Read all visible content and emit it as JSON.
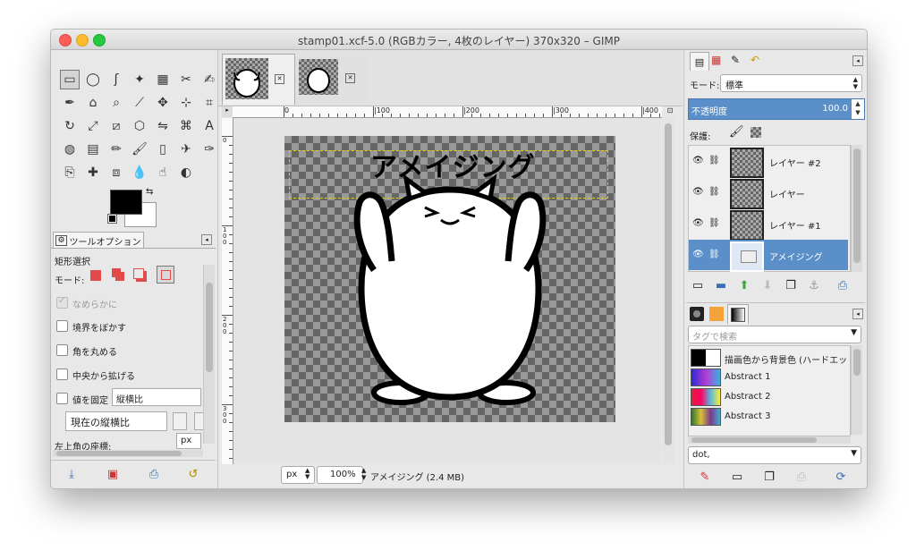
{
  "window": {
    "title": "stamp01.xcf-5.0 (RGBカラー, 4枚のレイヤー) 370x320 – GIMP"
  },
  "toolbox": {
    "tools": [
      "rect-select",
      "ellipse-select",
      "free-select",
      "fuzzy-select",
      "select-by-color",
      "scissors",
      "foreground-select",
      "paths",
      "color-picker",
      "zoom",
      "measure",
      "move",
      "align",
      "crop",
      "rotate",
      "scale",
      "shear",
      "perspective",
      "flip",
      "cage",
      "text",
      "bucket-fill",
      "blend",
      "pencil",
      "paintbrush",
      "eraser",
      "airbrush",
      "ink",
      "clone",
      "heal",
      "perspective-clone",
      "blur",
      "smudge",
      "dodge-burn"
    ],
    "fg_color": "#000000",
    "bg_color": "#ffffff"
  },
  "tool_options": {
    "tab_label": "ツールオプション",
    "tool_name": "矩形選択",
    "mode_label": "モード:",
    "antialias_label": "なめらかに",
    "feather_label": "境界をぼかす",
    "round_label": "角を丸める",
    "expand_label": "中央から拡げる",
    "fixed_label": "値を固定",
    "fixed_value": "縦横比",
    "ratio_value": "現在の縦横比",
    "position_label": "左上角の座標:",
    "position_unit": "px"
  },
  "image_tabs": [
    {
      "name": "thumb-1"
    },
    {
      "name": "thumb-2"
    }
  ],
  "ruler": {
    "labels": [
      "0",
      "|100",
      "|200",
      "|300",
      "|400"
    ],
    "v_labels": [
      "0",
      "1\n0\n0",
      "2\n0\n0",
      "3\n0\n0"
    ]
  },
  "canvas": {
    "text": "アメイジング"
  },
  "status": {
    "unit": "px",
    "zoom": "100%",
    "info": "アメイジング (2.4 MB)"
  },
  "layers_panel": {
    "mode_label": "モード:",
    "mode_value": "標準",
    "opacity_label": "不透明度",
    "opacity_value": "100.0",
    "lock_label": "保護:",
    "layers": [
      {
        "name": "レイヤー #2",
        "selected": false
      },
      {
        "name": "レイヤー",
        "selected": false
      },
      {
        "name": "レイヤー #1",
        "selected": false
      },
      {
        "name": "アメイジング",
        "selected": true
      }
    ]
  },
  "gradients_panel": {
    "search_placeholder": "タグで検索",
    "items": [
      {
        "name": "描画色から背景色 (ハードエッ"
      },
      {
        "name": "Abstract 1"
      },
      {
        "name": "Abstract 2"
      },
      {
        "name": "Abstract 3"
      }
    ],
    "tag_value": "dot,"
  },
  "colors": {
    "selection": "#5b8fc9",
    "accent": "#5b8fc9"
  }
}
